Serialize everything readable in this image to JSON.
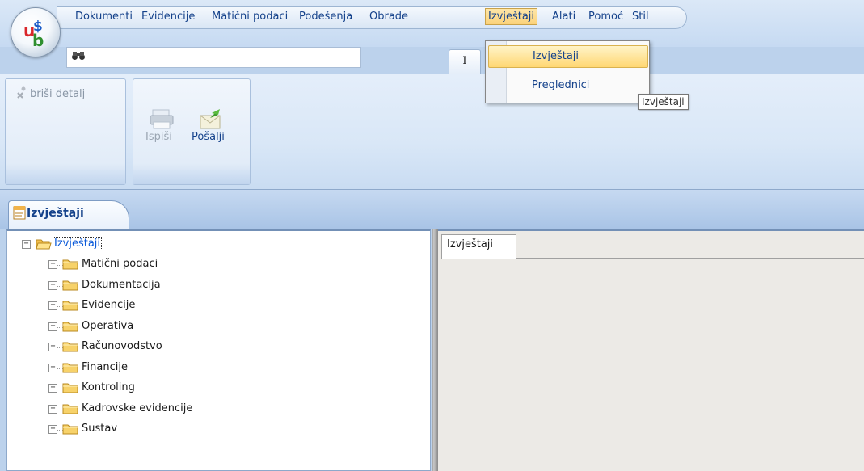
{
  "menu": {
    "items": [
      {
        "label": "Dokumenti"
      },
      {
        "label": "Evidencije"
      },
      {
        "label": "Matični podaci"
      },
      {
        "label": "Podešenja"
      },
      {
        "label": "Obrade"
      },
      {
        "label": "Izvještaji",
        "active": true
      },
      {
        "label": "Alati"
      },
      {
        "label": "Pomoć"
      },
      {
        "label": "Stil"
      }
    ]
  },
  "quick_tab": {
    "label": "I"
  },
  "search": {
    "placeholder": ""
  },
  "ribbon": {
    "delete_detail_label": "briši detalj",
    "print_label": "Ispiši",
    "send_label": "Pošalji"
  },
  "dropdown": {
    "items": [
      {
        "label": "Izvještaji",
        "highlighted": true
      },
      {
        "label": "Preglednici"
      }
    ]
  },
  "tooltip": {
    "text": "Izvještaji"
  },
  "document_tab": {
    "label": "Izvještaji"
  },
  "tree": {
    "root": {
      "label": "Izvještaji"
    },
    "children": [
      {
        "label": "Matični podaci"
      },
      {
        "label": "Dokumentacija"
      },
      {
        "label": "Evidencije"
      },
      {
        "label": "Operativa"
      },
      {
        "label": "Računovodstvo"
      },
      {
        "label": "Financije"
      },
      {
        "label": "Kontroling"
      },
      {
        "label": "Kadrovske evidencije"
      },
      {
        "label": "Sustav"
      }
    ]
  },
  "right_pane": {
    "tab_label": "Izvještaji"
  },
  "colors": {
    "accent": "#15428b",
    "menu_highlight": "#fbd27a",
    "folder": "#f7d26a",
    "selected_text": "#0b5ad9"
  }
}
